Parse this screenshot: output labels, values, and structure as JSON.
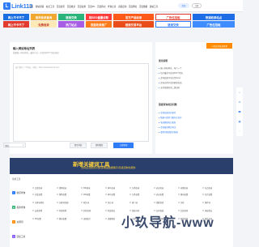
{
  "header": {
    "logo_letter": "L",
    "logo_text": "Link113",
    "nav": [
      "首页",
      "搜站思路",
      "站长工具",
      "百度资讯",
      "百度收录",
      "百度权重",
      "百度PC",
      "百度移动",
      "查询记录",
      "高级定制",
      "百度网址",
      "百度数据",
      "建站工具"
    ],
    "login": "登录",
    "register": "注册"
  },
  "ads": {
    "a1": "网上不卡不了",
    "a2": "网上不卡不了",
    "a3": "相关收录查询",
    "a4": "相SEO重量诊断",
    "a5": "官方产品收录",
    "a6": "广告位招租",
    "a7": "链接交换",
    "a8": "链接交易平台",
    "a9": "免费收录",
    "a10": "热门站点",
    "a11": "百度收录推广",
    "a12": "广告位招租",
    "a13": "链接交换",
    "a14": "快速收录站点"
  },
  "main": {
    "title": "输入网站地址列表",
    "subtitle": "批量输入网站地址，最多可以一次查询300个域名链接",
    "placeholder": "每行填写一个地址，例如：https://www.link113.com",
    "select_value": "默认",
    "btn_clear": "清空列表",
    "btn_dedupe": "清除重复",
    "btn_query": "立即查询"
  },
  "side": {
    "button": "+ 提交至收录检测",
    "title1": "使用说明",
    "items1": [
      "输入网站地址，每行一个",
      "每次最多可查询300个地址",
      "查询结果可导出至Excel",
      "查询过程中请勿刷新页面",
      "支持批量查询二级域名"
    ],
    "title2": "链接查询常见问题",
    "items2": [
      "查询结果仅供参考",
      "数据与搜索引擎存在差异",
      "收录数据每日更新",
      "查询慢请稍后再试",
      "遇到问题请联系客服"
    ]
  },
  "tools": {
    "banner_title": "新增关键词工具",
    "banner_sub": "支持主流搜索引擎/多维度数据展示/高级定制化服务",
    "head": "常用工具",
    "cats": [
      {
        "name": "收录查询",
        "icon": "search-icon",
        "color": "#2f7cf6"
      },
      {
        "name": "权重查询",
        "icon": "chart-icon",
        "color": "#23b26d"
      },
      {
        "name": "关键词",
        "icon": "key-icon",
        "color": "#ff8a00"
      },
      {
        "name": "链接工具",
        "icon": "link-icon",
        "color": "#8a5cf6"
      }
    ],
    "row1": [
      "百度收录",
      "搜狗收录",
      "360收录",
      "神马收录",
      "头条收录",
      "必应收录",
      "谷歌收录",
      "站点收录"
    ],
    "row2": [
      "百度权重",
      "搜狗权重",
      "360权重",
      "神马权重",
      "头条权重",
      "必应权重",
      "移动权重",
      "综合权重"
    ],
    "row3": [
      "关键词排名",
      "长尾词挖掘",
      "相关词",
      "竞价词",
      "热门词",
      "指数查询",
      "词库",
      "推荐词"
    ],
    "row4": [
      "友链检测",
      "死链检测",
      "外链查询",
      "死链提交",
      "链接分析",
      "站内链接",
      "反链查询",
      "链接提交"
    ],
    "row5": [
      "PC权重",
      "移动权重",
      "来路统计",
      "流量预估",
      "关键词数",
      "收录趋势",
      "快照查询",
      "域名信息"
    ]
  },
  "watermark": "小玖导航-www",
  "colors": {
    "accent": "#2f7cf6",
    "orange": "#ff8a00",
    "banner": "#2a3f6b",
    "banner_text": "#ffd23c"
  }
}
